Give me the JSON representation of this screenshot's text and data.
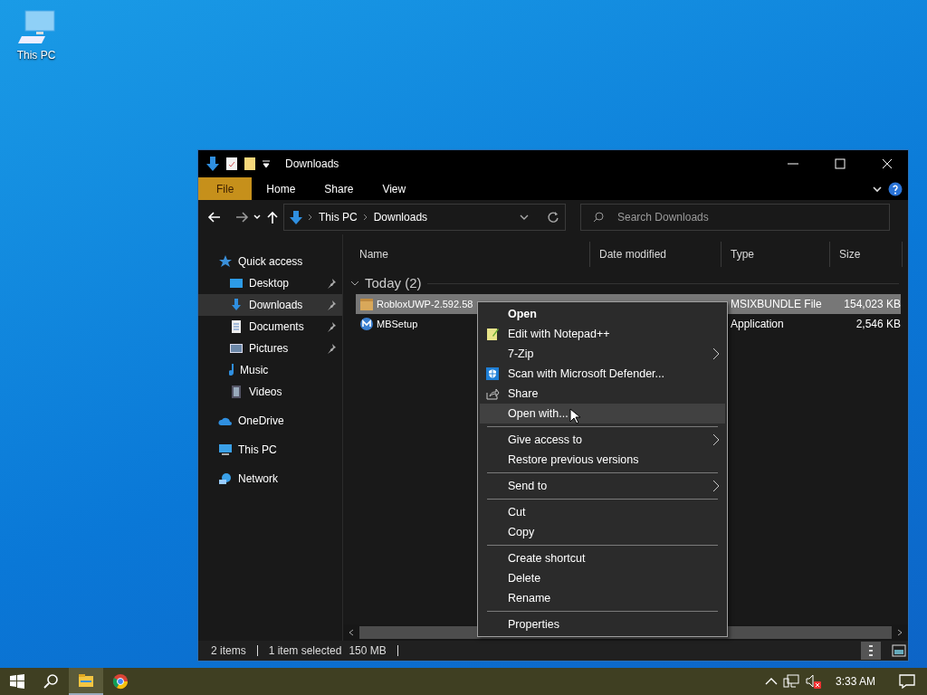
{
  "desktop_icons": [
    {
      "label": "This PC"
    }
  ],
  "window": {
    "title": "Downloads",
    "ribbon_tabs": [
      {
        "label": "File",
        "selected": true
      },
      {
        "label": "Home",
        "selected": false
      },
      {
        "label": "Share",
        "selected": false
      },
      {
        "label": "View",
        "selected": false
      }
    ],
    "address": {
      "path": [
        "This PC",
        "Downloads"
      ]
    },
    "search": {
      "placeholder": "Search Downloads"
    },
    "sidebar": {
      "items": [
        {
          "label": "Quick access",
          "selected": false,
          "children": [
            {
              "label": "Desktop",
              "pinned": true,
              "selected": false
            },
            {
              "label": "Downloads",
              "pinned": true,
              "selected": true
            },
            {
              "label": "Documents",
              "pinned": true,
              "selected": false
            },
            {
              "label": "Pictures",
              "pinned": true,
              "selected": false
            },
            {
              "label": "Music",
              "pinned": false,
              "selected": false
            },
            {
              "label": "Videos",
              "pinned": false,
              "selected": false
            }
          ]
        },
        {
          "label": "OneDrive",
          "selected": false
        },
        {
          "label": "This PC",
          "selected": false
        },
        {
          "label": "Network",
          "selected": false
        }
      ]
    },
    "columns": [
      "Name",
      "Date modified",
      "Type",
      "Size"
    ],
    "groups": [
      {
        "label": "Today (2)",
        "expanded": true,
        "rows": [
          {
            "name": "RobloxUWP-2.592.58",
            "type": "MSIXBUNDLE File",
            "size": "154,023 KB",
            "selected": true
          },
          {
            "name": "MBSetup",
            "type": "Application",
            "size": "2,546 KB",
            "selected": false
          }
        ]
      }
    ],
    "status_bar": {
      "count": "2 items",
      "selection": "1 item selected",
      "selection_size": "150 MB"
    }
  },
  "context_menu": {
    "items": [
      {
        "kind": "item",
        "label": "Open",
        "default": true,
        "submenu": false,
        "selected": false
      },
      {
        "kind": "item",
        "label": "Edit with Notepad++",
        "default": false,
        "submenu": false,
        "selected": false
      },
      {
        "kind": "item",
        "label": "7-Zip",
        "default": false,
        "submenu": true,
        "selected": false
      },
      {
        "kind": "item",
        "label": "Scan with Microsoft Defender...",
        "default": false,
        "submenu": false,
        "selected": false
      },
      {
        "kind": "item",
        "label": "Share",
        "default": false,
        "submenu": false,
        "selected": false
      },
      {
        "kind": "item",
        "label": "Open with...",
        "default": false,
        "submenu": false,
        "selected": true
      },
      {
        "kind": "separator"
      },
      {
        "kind": "item",
        "label": "Give access to",
        "default": false,
        "submenu": true,
        "selected": false
      },
      {
        "kind": "item",
        "label": "Restore previous versions",
        "default": false,
        "submenu": false,
        "selected": false
      },
      {
        "kind": "separator"
      },
      {
        "kind": "item",
        "label": "Send to",
        "default": false,
        "submenu": true,
        "selected": false
      },
      {
        "kind": "separator"
      },
      {
        "kind": "item",
        "label": "Cut",
        "default": false,
        "submenu": false,
        "selected": false
      },
      {
        "kind": "item",
        "label": "Copy",
        "default": false,
        "submenu": false,
        "selected": false
      },
      {
        "kind": "separator"
      },
      {
        "kind": "item",
        "label": "Create shortcut",
        "default": false,
        "submenu": false,
        "selected": false
      },
      {
        "kind": "item",
        "label": "Delete",
        "default": false,
        "submenu": false,
        "selected": false
      },
      {
        "kind": "item",
        "label": "Rename",
        "default": false,
        "submenu": false,
        "selected": false
      },
      {
        "kind": "separator"
      },
      {
        "kind": "item",
        "label": "Properties",
        "default": false,
        "submenu": false,
        "selected": false
      }
    ]
  },
  "taskbar": {
    "clock": "3:33 AM"
  }
}
